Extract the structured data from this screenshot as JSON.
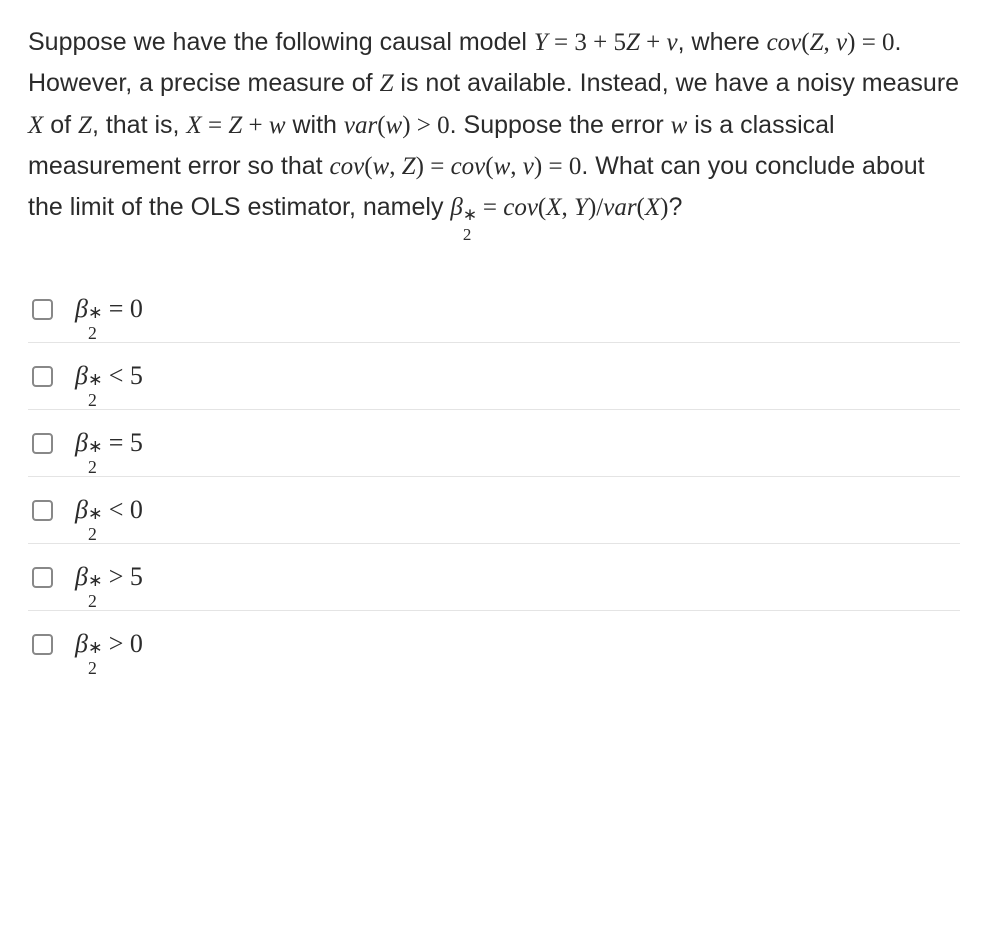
{
  "question": {
    "p1a": "Suppose we have the following causal model ",
    "expr1": "Y = 3 + 5Z + v",
    "p1b": ", where ",
    "expr2": "cov(Z, v) = 0",
    "p1c": ". However, a precise measure of ",
    "varZ": "Z",
    "p1d": " is not available. Instead, we have a noisy measure ",
    "varX": "X",
    "p1e": " of ",
    "p1f": ", that is, ",
    "expr3": "X = Z + w",
    "p1g": " with ",
    "expr4": "var(w) > 0",
    "p1h": ". Suppose the error ",
    "varw": "w",
    "p1i": " is a classical measurement error so that ",
    "expr5": "cov(w, Z) = cov(w, v) = 0",
    "p1j": ". What can you conclude about the limit of the OLS estimator, namely ",
    "expr6_lhs_beta": "β",
    "expr6_lhs_sup": "∗",
    "expr6_lhs_sub": "2",
    "expr6_eq": " = ",
    "expr6_rhs": "cov(X, Y)/var(X)",
    "p1k": "?"
  },
  "options": [
    {
      "beta": "β",
      "sup": "∗",
      "sub": "2",
      "rel": " = ",
      "val": "0"
    },
    {
      "beta": "β",
      "sup": "∗",
      "sub": "2",
      "rel": " < ",
      "val": "5"
    },
    {
      "beta": "β",
      "sup": "∗",
      "sub": "2",
      "rel": " = ",
      "val": "5"
    },
    {
      "beta": "β",
      "sup": "∗",
      "sub": "2",
      "rel": " < ",
      "val": "0"
    },
    {
      "beta": "β",
      "sup": "∗",
      "sub": "2",
      "rel": " > ",
      "val": "5"
    },
    {
      "beta": "β",
      "sup": "∗",
      "sub": "2",
      "rel": " > ",
      "val": "0"
    }
  ]
}
